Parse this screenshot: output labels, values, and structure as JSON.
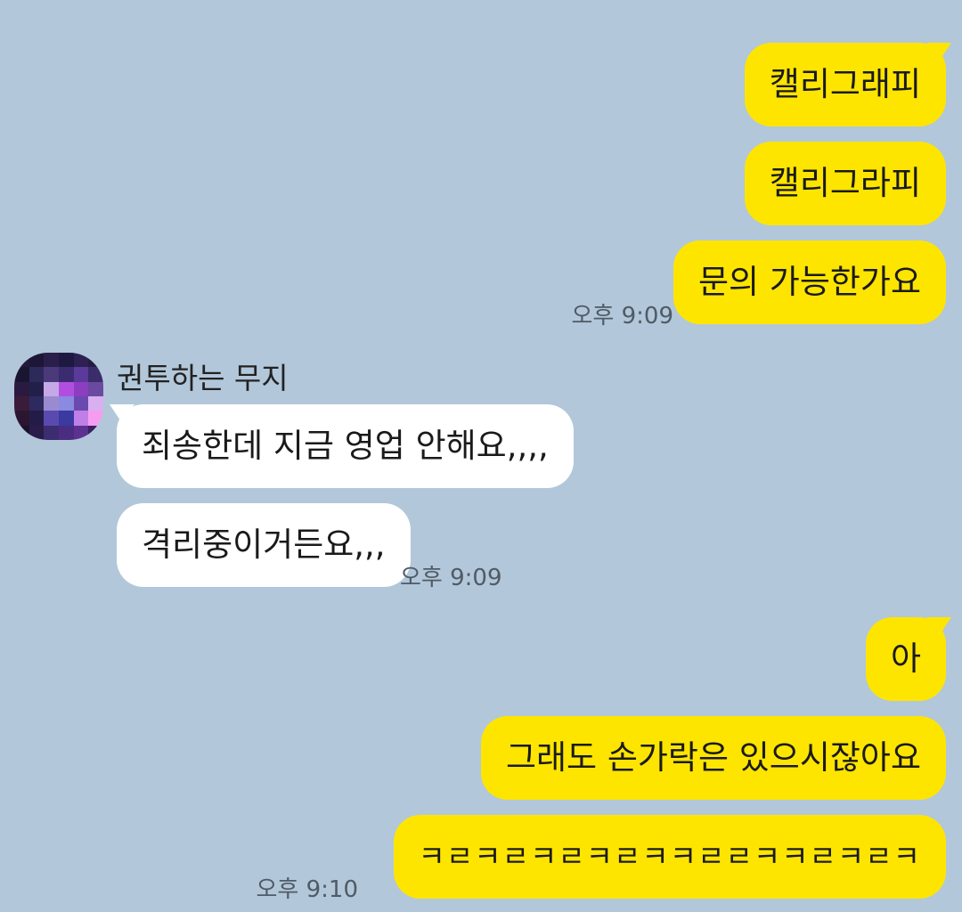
{
  "messages_top": [
    {
      "text": "캘리그래피"
    },
    {
      "text": "캘리그라피"
    },
    {
      "text": "문의 가능한가요"
    }
  ],
  "time_1": "오후 9:09",
  "contact": {
    "name": "권투하는 무지"
  },
  "messages_them": [
    {
      "text": "죄송한데 지금 영업 안해요,,,,"
    },
    {
      "text": "격리중이거든요,,,"
    }
  ],
  "time_2": "오후 9:09",
  "messages_bottom": [
    {
      "text": "아"
    },
    {
      "text": "그래도 손가락은 있으시잖아요"
    },
    {
      "text": "ㅋㄹㅋㄹㅋㄹㅋㄹㅋㅋㄹㄹㅋㅋㄹㅋㄹㅋ"
    }
  ],
  "time_3": "오후 9:10",
  "colors": {
    "background": "#b2c7da",
    "my_bubble": "#fee500",
    "their_bubble": "#ffffff"
  },
  "icons": {
    "avatar": "pixelated-avatar-icon"
  }
}
